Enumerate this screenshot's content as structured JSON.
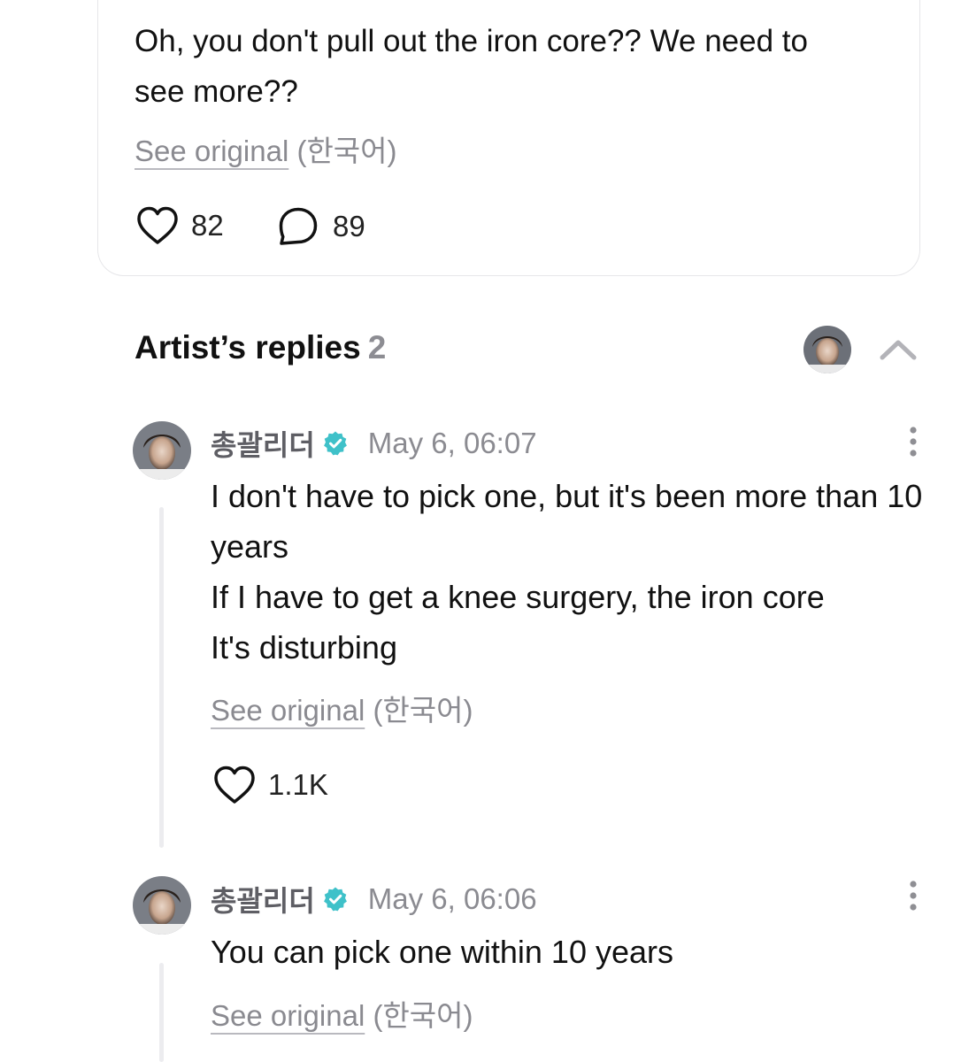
{
  "post": {
    "text": "Oh, you don't pull out the iron core?? We need to see more??",
    "see_original": "See original",
    "language": "(한국어)",
    "likes": "82",
    "comments": "89"
  },
  "artist_replies": {
    "title": "Artist’s replies",
    "count": "2"
  },
  "replies": [
    {
      "author": "총괄리더",
      "date": "May 6, 06:07",
      "text": "I don't have to pick one, but it's been more than 10 years\nIf I have to get a knee surgery, the iron core\nIt's disturbing",
      "see_original": "See original",
      "language": "(한국어)",
      "likes": "1.1K"
    },
    {
      "author": "총괄리더",
      "date": "May 6, 06:06",
      "text": "You can pick one within 10 years",
      "see_original": "See original",
      "language": "(한국어)"
    }
  ],
  "icons": {
    "like": "heart-icon",
    "comment": "speech-bubble-icon",
    "verified": "verified-badge-icon",
    "more": "more-vertical-icon",
    "collapse": "chevron-up-icon"
  },
  "colors": {
    "verified": "#3fc1c9",
    "muted_text": "#8a8a90",
    "card_border": "#e6e6e9"
  }
}
